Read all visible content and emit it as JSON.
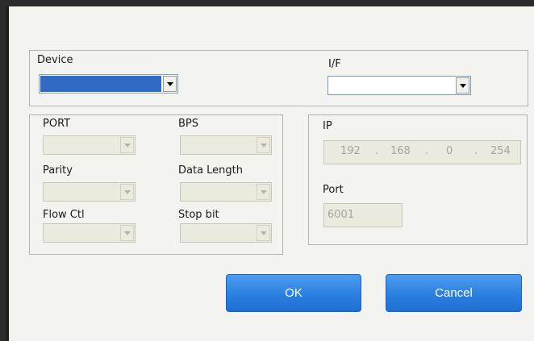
{
  "device": {
    "label": "Device",
    "value": ""
  },
  "interface": {
    "label": "I/F",
    "value": ""
  },
  "serial": {
    "port": {
      "label": "PORT",
      "value": ""
    },
    "bps": {
      "label": "BPS",
      "value": ""
    },
    "parity": {
      "label": "Parity",
      "value": ""
    },
    "data_length": {
      "label": "Data Length",
      "value": ""
    },
    "flow_ctl": {
      "label": "Flow Ctl",
      "value": ""
    },
    "stop_bit": {
      "label": "Stop bit",
      "value": ""
    }
  },
  "network": {
    "ip": {
      "label": "IP",
      "octets": [
        "192",
        "168",
        "0",
        "254"
      ],
      "dot": "."
    },
    "port": {
      "label": "Port",
      "value": "6001"
    }
  },
  "buttons": {
    "ok": "OK",
    "cancel": "Cancel"
  },
  "colors": {
    "button_blue": "#2b7fe0",
    "selection_blue": "#316ac5",
    "disabled_fill": "#ebeade"
  }
}
